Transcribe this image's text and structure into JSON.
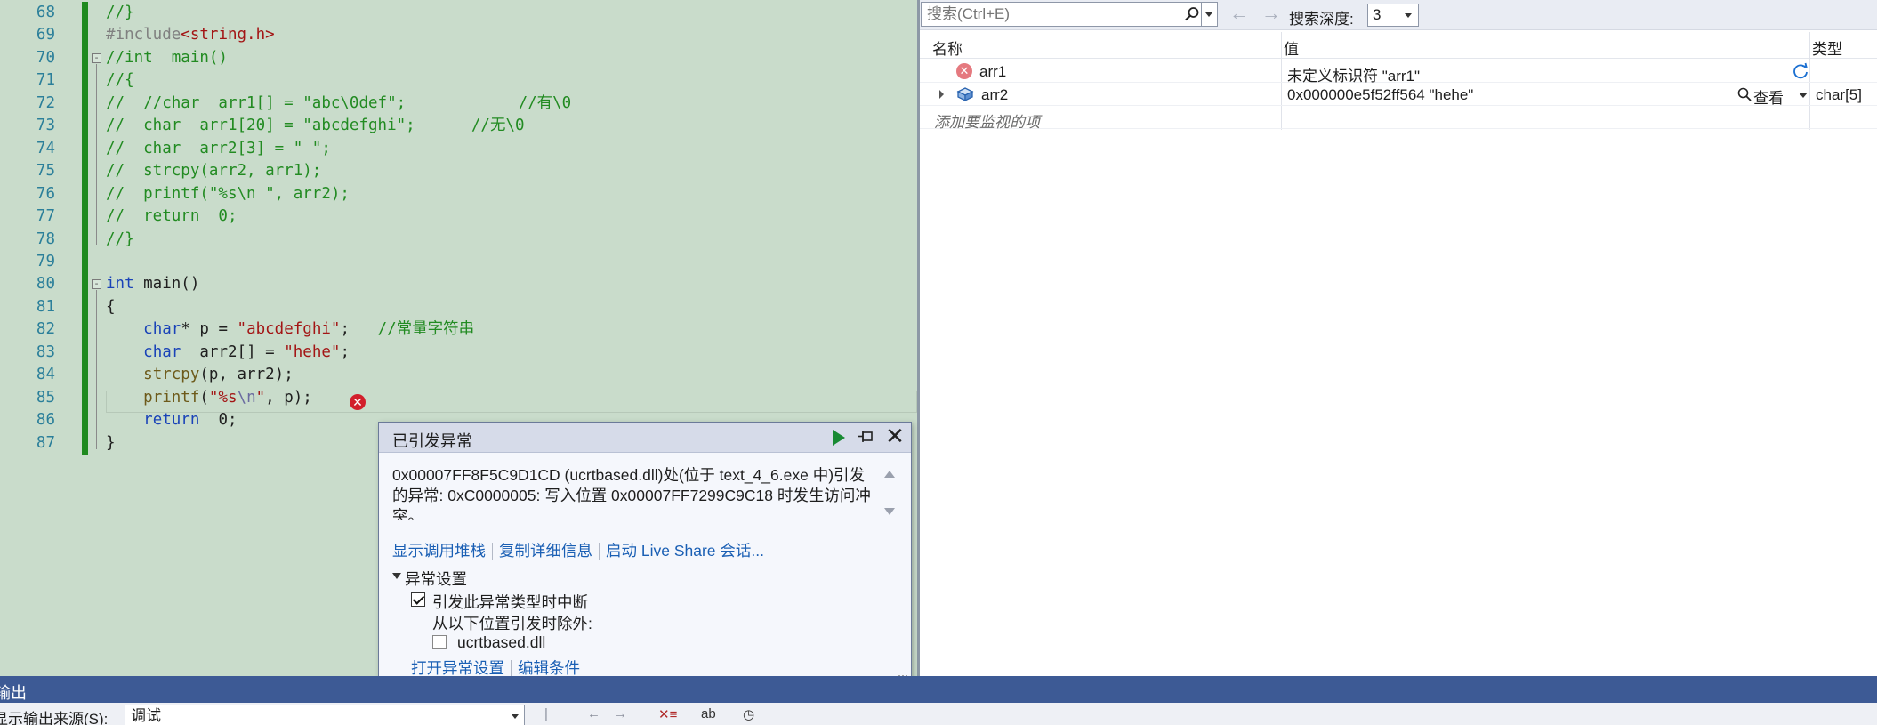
{
  "editor": {
    "lines": [
      {
        "n": "68",
        "segs": [
          {
            "t": "//}",
            "c": "c-comment"
          }
        ]
      },
      {
        "n": "69",
        "segs": [
          {
            "t": "#include",
            "c": "c-pp"
          },
          {
            "t": "<string.h>",
            "c": "c-str"
          }
        ]
      },
      {
        "n": "70",
        "segs": [
          {
            "t": "//int  main()",
            "c": "c-comment"
          }
        ],
        "fold": "-"
      },
      {
        "n": "71",
        "segs": [
          {
            "t": "//{",
            "c": "c-comment"
          }
        ]
      },
      {
        "n": "72",
        "segs": [
          {
            "t": "//  //char  arr1[] = \"abc\\0def\";            //有\\0",
            "c": "c-comment"
          }
        ]
      },
      {
        "n": "73",
        "segs": [
          {
            "t": "//  char  arr1[20] = \"abcdefghi\";      //无\\0",
            "c": "c-comment"
          }
        ]
      },
      {
        "n": "74",
        "segs": [
          {
            "t": "//  char  arr2[3] = \" \";",
            "c": "c-comment"
          }
        ]
      },
      {
        "n": "75",
        "segs": [
          {
            "t": "//  strcpy(arr2, arr1);",
            "c": "c-comment"
          }
        ]
      },
      {
        "n": "76",
        "segs": [
          {
            "t": "//  printf(\"%s\\n \", arr2);",
            "c": "c-comment"
          }
        ]
      },
      {
        "n": "77",
        "segs": [
          {
            "t": "//  return  0;",
            "c": "c-comment"
          }
        ]
      },
      {
        "n": "78",
        "segs": [
          {
            "t": "//}",
            "c": "c-comment"
          }
        ]
      },
      {
        "n": "79",
        "segs": []
      },
      {
        "n": "80",
        "segs": [
          {
            "t": "int",
            "c": "c-kw"
          },
          {
            "t": " main()",
            "c": "c-id"
          }
        ],
        "fold": "-"
      },
      {
        "n": "81",
        "segs": [
          {
            "t": "{",
            "c": "c-id"
          }
        ]
      },
      {
        "n": "82",
        "segs": [
          {
            "t": "    ",
            "c": "c-id"
          },
          {
            "t": "char",
            "c": "c-kw"
          },
          {
            "t": "* p = ",
            "c": "c-id"
          },
          {
            "t": "\"abcdefghi\"",
            "c": "c-str"
          },
          {
            "t": ";   ",
            "c": "c-id"
          },
          {
            "t": "//常量字符串",
            "c": "c-comment"
          }
        ]
      },
      {
        "n": "83",
        "segs": [
          {
            "t": "    ",
            "c": "c-id"
          },
          {
            "t": "char",
            "c": "c-kw"
          },
          {
            "t": "  arr2[] = ",
            "c": "c-id"
          },
          {
            "t": "\"hehe\"",
            "c": "c-str"
          },
          {
            "t": ";",
            "c": "c-id"
          }
        ]
      },
      {
        "n": "84",
        "segs": [
          {
            "t": "    ",
            "c": "c-id"
          },
          {
            "t": "strcpy",
            "c": "c-fn"
          },
          {
            "t": "(p, arr2);",
            "c": "c-id"
          }
        ]
      },
      {
        "n": "85",
        "segs": [
          {
            "t": "    ",
            "c": "c-id"
          },
          {
            "t": "printf",
            "c": "c-fn"
          },
          {
            "t": "(",
            "c": "c-id"
          },
          {
            "t": "\"%s",
            "c": "c-str"
          },
          {
            "t": "\\n",
            "c": "c-esc"
          },
          {
            "t": "\"",
            "c": "c-str"
          },
          {
            "t": ", p);",
            "c": "c-id"
          }
        ]
      },
      {
        "n": "86",
        "segs": [
          {
            "t": "    ",
            "c": "c-id"
          },
          {
            "t": "return",
            "c": "c-kw"
          },
          {
            "t": "  0;",
            "c": "c-id"
          }
        ]
      },
      {
        "n": "87",
        "segs": [
          {
            "t": "}",
            "c": "c-id"
          }
        ]
      }
    ],
    "error_glyph": "✕"
  },
  "watch": {
    "search_placeholder": "搜索(Ctrl+E)",
    "nav_back": "←",
    "nav_forward": "→",
    "depth_label": "搜索深度:",
    "depth_value": "3",
    "col_name": "名称",
    "col_value": "值",
    "col_type": "类型",
    "rows": [
      {
        "name": "arr1",
        "value": "未定义标识符 \"arr1\"",
        "type": ""
      },
      {
        "name": "arr2",
        "value": "0x000000e5f52ff564 \"hehe\"",
        "type": "char[5]",
        "view": "查看"
      }
    ],
    "add_placeholder": "添加要监视的项"
  },
  "exception": {
    "title": "已引发异常",
    "message": "0x00007FF8F5C9D1CD (ucrtbased.dll)处(位于 text_4_6.exe 中)引发的异常: 0xC0000005: 写入位置 0x00007FF7299C9C18 时发生访问冲突。",
    "links": [
      "显示调用堆栈",
      "复制详细信息",
      "启动 Live Share 会话..."
    ],
    "settings_label": "异常设置",
    "break_label": "引发此异常类型时中断",
    "except_label": "从以下位置引发时除外:",
    "dll_label": "ucrtbased.dll",
    "bottom_links": [
      "打开异常设置",
      "编辑条件"
    ]
  },
  "output": {
    "title": "输出",
    "source_label": "显示输出来源(S):",
    "source_value": "调试"
  },
  "colors": {
    "editor_bg": "#c9dccb",
    "change_bar": "#1f8a1f",
    "output_title_bg": "#3d5a95",
    "link": "#1a5fb4"
  }
}
